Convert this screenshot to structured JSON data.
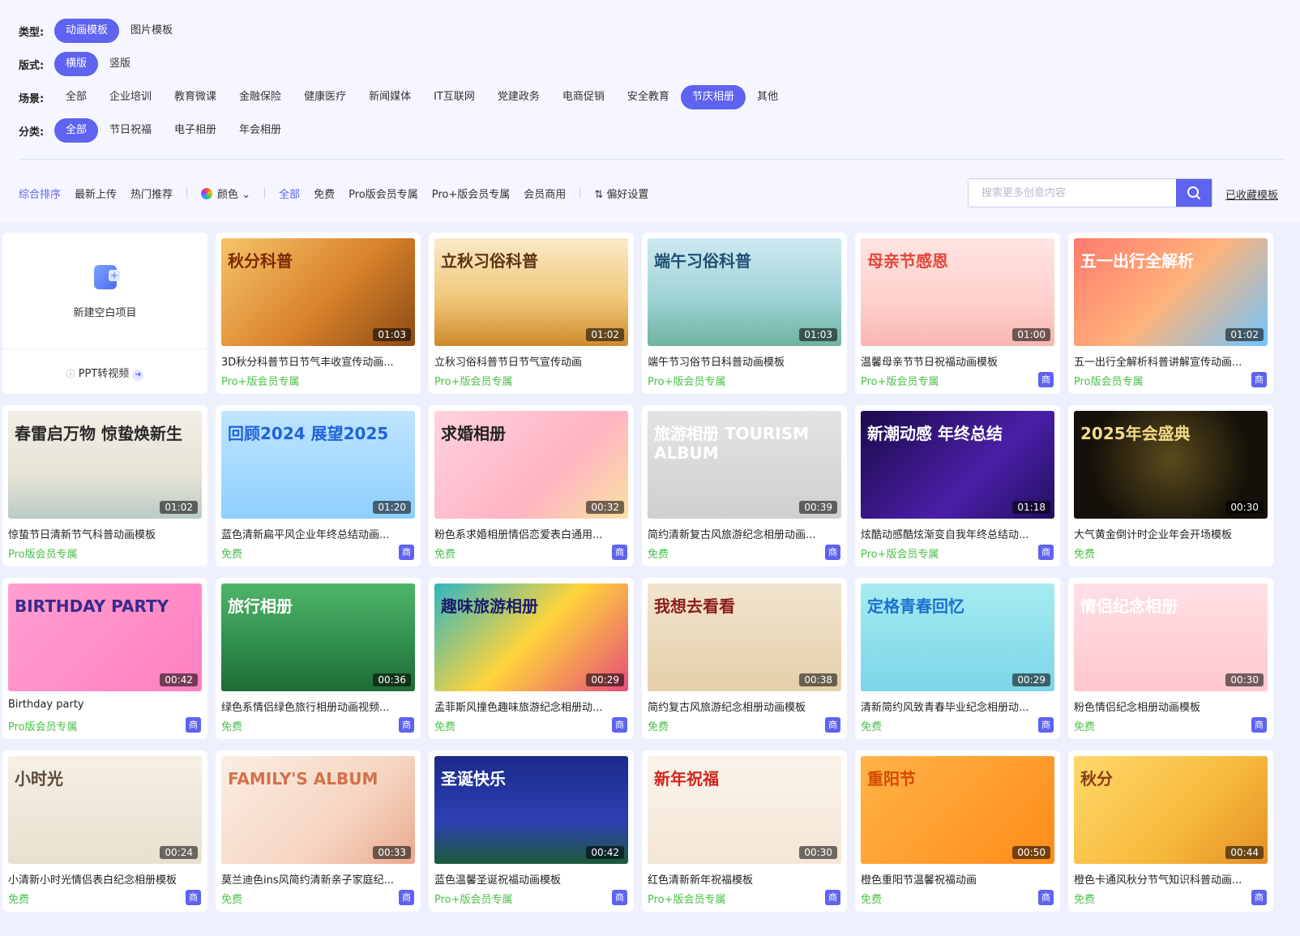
{
  "filters": {
    "type": {
      "label": "类型:",
      "options": [
        "动画模板",
        "图片模板"
      ],
      "active": 0
    },
    "layout": {
      "label": "版式:",
      "options": [
        "横版",
        "竖版"
      ],
      "active": 0
    },
    "scene": {
      "label": "场景:",
      "options": [
        "全部",
        "企业培训",
        "教育微课",
        "金融保险",
        "健康医疗",
        "新闻媒体",
        "IT互联网",
        "党建政务",
        "电商促销",
        "安全教育",
        "节庆相册",
        "其他"
      ],
      "active": 10
    },
    "category": {
      "label": "分类:",
      "options": [
        "全部",
        "节日祝福",
        "电子相册",
        "年会相册"
      ],
      "active": 0
    }
  },
  "sort": {
    "items": [
      "综合排序",
      "最新上传",
      "热门推荐"
    ],
    "active": 0,
    "color_label": "颜色",
    "price_items": [
      "全部",
      "免费",
      "Pro版会员专属",
      "Pro+版会员专属",
      "会员商用"
    ],
    "price_active": 0,
    "pref_label": "偏好设置"
  },
  "search": {
    "placeholder": "搜索更多创意内容"
  },
  "favorites_label": "已收藏模板",
  "new_card": {
    "label": "新建空白项目",
    "ppt_link": "PPT转视频"
  },
  "badge_text": "商",
  "colors": {
    "accent": "#5e63f0",
    "free": "#4cc04c",
    "pro": "#4cc04c"
  },
  "cards": [
    {
      "title": "3D秋分科普节日节气丰收宣传动画...",
      "tag": "Pro+版会员专属",
      "duration": "01:03",
      "badge": false,
      "thumb_text": "秋分科普",
      "bg": "linear-gradient(135deg,#f6c46a,#d9822b 55%,#8a4a14)",
      "fg": "#7a2a06"
    },
    {
      "title": "立秋习俗科普节日节气宣传动画",
      "tag": "Pro+版会员专属",
      "duration": "01:02",
      "badge": false,
      "thumb_text": "立秋习俗科普",
      "bg": "linear-gradient(180deg,#fbe9c8,#f0c87a 55%,#d08a2c)",
      "fg": "#5a3412"
    },
    {
      "title": "端午节习俗节日科普动画模板",
      "tag": "Pro+版会员专属",
      "duration": "01:03",
      "badge": false,
      "thumb_text": "端午习俗科普",
      "bg": "linear-gradient(180deg,#cfeaf2,#9fd3d7 55%,#6fb3a0)",
      "fg": "#1f4f73"
    },
    {
      "title": "温馨母亲节节日祝福动画模板",
      "tag": "Pro+版会员专属",
      "duration": "01:00",
      "badge": true,
      "thumb_text": "母亲节感恩",
      "bg": "linear-gradient(180deg,#ffe4e1,#ffd0cc 60%,#f7b6b0)",
      "fg": "#e2483d"
    },
    {
      "title": "五一出行全解析科普讲解宣传动画...",
      "tag": "Pro版会员专属",
      "duration": "01:02",
      "badge": true,
      "thumb_text": "五一出行全解析",
      "bg": "linear-gradient(135deg,#ff7a6e,#ffb27a 50%,#6ec6ff)",
      "fg": "#ffffff"
    },
    {
      "title": "惊蛰节日清新节气科普动画模板",
      "tag": "Pro版会员专属",
      "duration": "01:02",
      "badge": false,
      "thumb_text": "春雷启万物 惊蛰焕新生",
      "bg": "linear-gradient(180deg,#f3efe6,#e6e2d6 60%,#b9cbc6)",
      "fg": "#2a2a2a"
    },
    {
      "title": "蓝色清新扁平风企业年终总结动画...",
      "tag": "免费",
      "duration": "01:20",
      "badge": true,
      "thumb_text": "回顾2024 展望2025",
      "bg": "linear-gradient(180deg,#bfe4ff,#8fd0ff)",
      "fg": "#1f63d8"
    },
    {
      "title": "粉色系求婚相册情侣恋爱表白通用...",
      "tag": "免费",
      "duration": "00:32",
      "badge": true,
      "thumb_text": "求婚相册",
      "bg": "linear-gradient(135deg,#ffd3dd,#ffb3c4 60%,#f9e1a0)",
      "fg": "#222222"
    },
    {
      "title": "简约清新复古风旅游纪念相册动画...",
      "tag": "免费",
      "duration": "00:39",
      "badge": true,
      "thumb_text": "旅游相册 TOURISM ALBUM",
      "bg": "linear-gradient(180deg,#e4e4e4,#cfcfcf)",
      "fg": "#ffffff"
    },
    {
      "title": "炫酷动感酷炫渐变自我年终总结动...",
      "tag": "Pro+版会员专属",
      "duration": "01:18",
      "badge": true,
      "thumb_text": "新潮动感 年终总结",
      "bg": "linear-gradient(135deg,#1b0a4a,#4b1fa8 60%,#221060)",
      "fg": "#ffffff"
    },
    {
      "title": "大气黄金倒计时企业年会开场模板",
      "tag": "免费",
      "duration": "00:30",
      "badge": false,
      "thumb_text": "2025年会盛典",
      "bg": "radial-gradient(circle at 50% 45%,#5a4a1c,#15110a 70%)",
      "fg": "#f4d98a"
    },
    {
      "title": "Birthday party",
      "tag": "Pro版会员专属",
      "duration": "00:42",
      "badge": true,
      "thumb_text": "BIRTHDAY PARTY",
      "bg": "linear-gradient(135deg,#ff9fd0,#ff7fc0)",
      "fg": "#3a2a8a"
    },
    {
      "title": "绿色系情侣绿色旅行相册动画视频...",
      "tag": "免费",
      "duration": "00:36",
      "badge": true,
      "thumb_text": "旅行相册",
      "bg": "linear-gradient(180deg,#4fb56a,#2e8b4a 60%,#1f6b34)",
      "fg": "#ffffff"
    },
    {
      "title": "孟菲斯风撞色趣味旅游纪念相册动...",
      "tag": "免费",
      "duration": "00:29",
      "badge": true,
      "thumb_text": "趣味旅游相册",
      "bg": "linear-gradient(135deg,#2fb6c0,#ffd43b 50%,#e74a7b)",
      "fg": "#1b1b6a"
    },
    {
      "title": "简约复古风旅游纪念相册动画模板",
      "tag": "免费",
      "duration": "00:38",
      "badge": true,
      "thumb_text": "我想去看看",
      "bg": "linear-gradient(180deg,#f1e4cf,#e5cfa9)",
      "fg": "#8b1c1c"
    },
    {
      "title": "清新简约风致青春毕业纪念相册动...",
      "tag": "免费",
      "duration": "00:29",
      "badge": true,
      "thumb_text": "定格青春回忆",
      "bg": "linear-gradient(180deg,#a6ecf0,#7ad5e8)",
      "fg": "#1e6fd0"
    },
    {
      "title": "粉色情侣纪念相册动画模板",
      "tag": "免费",
      "duration": "00:30",
      "badge": true,
      "thumb_text": "情侣纪念相册",
      "bg": "linear-gradient(180deg,#ffe0e4,#ffc7cf)",
      "fg": "#ffffff"
    },
    {
      "title": "小清新小时光情侣表白纪念相册模板",
      "tag": "免费",
      "duration": "00:24",
      "badge": true,
      "thumb_text": "小时光",
      "bg": "linear-gradient(180deg,#f5efe4,#e8e0cf)",
      "fg": "#5b4a3a"
    },
    {
      "title": "莫兰迪色ins风简约清新亲子家庭纪...",
      "tag": "免费",
      "duration": "00:33",
      "badge": true,
      "thumb_text": "FAMILY'S ALBUM",
      "bg": "linear-gradient(135deg,#fbeee3,#f6d5c2 60%,#e9a98c)",
      "fg": "#d2724c"
    },
    {
      "title": "蓝色温馨圣诞祝福动画模板",
      "tag": "Pro+版会员专属",
      "duration": "00:42",
      "badge": true,
      "thumb_text": "圣诞快乐",
      "bg": "linear-gradient(180deg,#1a2a8a,#2e3fb4 60%,#1b5a3a)",
      "fg": "#ffffff"
    },
    {
      "title": "红色清新新年祝福模板",
      "tag": "Pro+版会员专属",
      "duration": "00:30",
      "badge": true,
      "thumb_text": "新年祝福",
      "bg": "linear-gradient(180deg,#fbf3ea,#f4e6d6)",
      "fg": "#d0261e"
    },
    {
      "title": "橙色重阳节温馨祝福动画",
      "tag": "免费",
      "duration": "00:50",
      "badge": true,
      "thumb_text": "重阳节",
      "bg": "linear-gradient(135deg,#ffb347,#ff8c1a)",
      "fg": "#d44a00"
    },
    {
      "title": "橙色卡通风秋分节气知识科普动画...",
      "tag": "免费",
      "duration": "00:44",
      "badge": true,
      "thumb_text": "秋分",
      "bg": "linear-gradient(135deg,#ffd86b,#f6b93b 60%,#e58e26)",
      "fg": "#8a3d12"
    }
  ]
}
